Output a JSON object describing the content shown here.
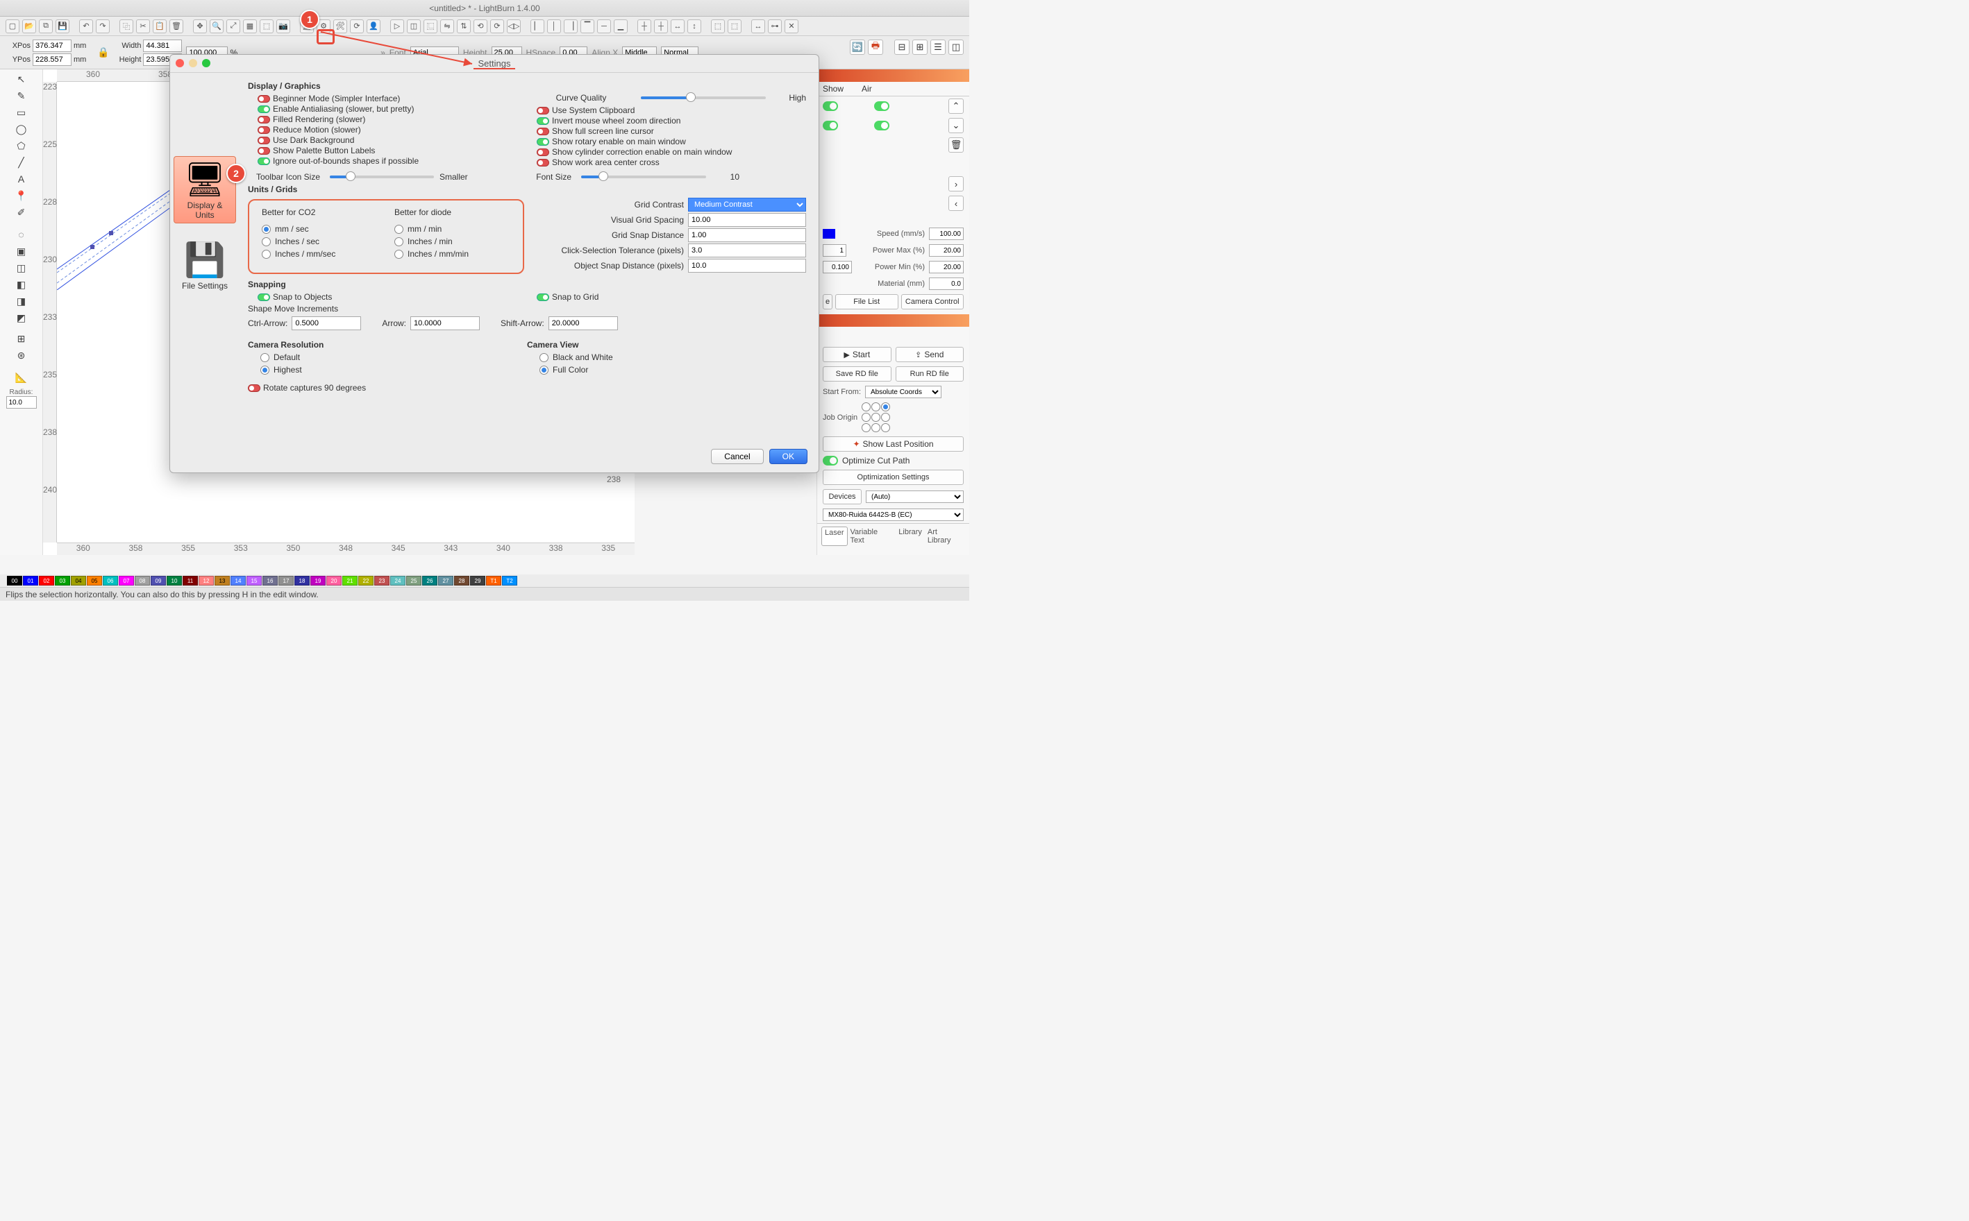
{
  "window": {
    "title": "<untitled> * - LightBurn 1.4.00"
  },
  "propbar": {
    "xpos_label": "XPos",
    "xpos": "376.347",
    "ypos_label": "YPos",
    "ypos": "228.557",
    "unit": "mm",
    "width_label": "Width",
    "width": "44.381",
    "height_label": "Height",
    "height": "23.595",
    "width2": "100.000",
    "font_label": "Font",
    "font": "Arial",
    "h_label": "Height",
    "hval": "25.00",
    "hs_label": "HSpace",
    "hs": "0.00",
    "alignx": "Align X",
    "alignxv": "Middle",
    "norm": "Normal"
  },
  "left": {
    "radius_label": "Radius:",
    "radius": "10.0"
  },
  "ruler_top": [
    "360",
    "358"
  ],
  "ruler_left": [
    "223",
    "225",
    "228",
    "230",
    "233",
    "235",
    "238",
    "240"
  ],
  "ruler_bot": [
    "360",
    "358",
    "355",
    "353",
    "350",
    "348",
    "345",
    "343",
    "340",
    "338",
    "335"
  ],
  "right": {
    "header1": "Show",
    "header2": "Air",
    "speed_label": "Speed (mm/s)",
    "speed": "100.00",
    "pmax_label": "Power Max (%)",
    "pmax": "20.00",
    "pmin_label": "Power Min (%)",
    "pmin": "20.00",
    "mat_label": "Material (mm)",
    "mat": "0.0",
    "one": "1",
    "hundred": "0.100",
    "file_list": "File List",
    "cam_ctl": "Camera Control",
    "start": "Start",
    "send": "Send",
    "save_rd": "Save RD file",
    "run_rd": "Run RD file",
    "start_from": "Start From:",
    "start_from_v": "Absolute Coords",
    "job_origin": "Job Origin",
    "show_last": "Show Last Position",
    "opt_cut": "Optimize Cut Path",
    "opt_set": "Optimization Settings",
    "devices": "Devices",
    "dev_auto": "(Auto)",
    "conn": "MX80-Ruida 6442S-B (EC)",
    "tabs": [
      "Laser",
      "Variable Text",
      "Library",
      "Art Library"
    ]
  },
  "palette": [
    {
      "n": "00",
      "c": "#000000"
    },
    {
      "n": "01",
      "c": "#0000ff"
    },
    {
      "n": "02",
      "c": "#ff0000"
    },
    {
      "n": "03",
      "c": "#00a000"
    },
    {
      "n": "04",
      "c": "#a0a000"
    },
    {
      "n": "05",
      "c": "#ff8000"
    },
    {
      "n": "06",
      "c": "#00c0c0"
    },
    {
      "n": "07",
      "c": "#ff00ff"
    },
    {
      "n": "08",
      "c": "#a0a0a0"
    },
    {
      "n": "09",
      "c": "#5050b0"
    },
    {
      "n": "10",
      "c": "#008040"
    },
    {
      "n": "11",
      "c": "#800000"
    },
    {
      "n": "12",
      "c": "#ff8080"
    },
    {
      "n": "13",
      "c": "#c08020"
    },
    {
      "n": "14",
      "c": "#5080ff"
    },
    {
      "n": "15",
      "c": "#c060ff"
    },
    {
      "n": "16",
      "c": "#707090"
    },
    {
      "n": "17",
      "c": "#909090"
    },
    {
      "n": "18",
      "c": "#3030a0"
    },
    {
      "n": "19",
      "c": "#c000c0"
    },
    {
      "n": "20",
      "c": "#ff60a0"
    },
    {
      "n": "21",
      "c": "#60e000"
    },
    {
      "n": "22",
      "c": "#b0b000"
    },
    {
      "n": "23",
      "c": "#c05050"
    },
    {
      "n": "24",
      "c": "#60c0c0"
    },
    {
      "n": "25",
      "c": "#80a080"
    },
    {
      "n": "26",
      "c": "#008080"
    },
    {
      "n": "27",
      "c": "#6090a0"
    },
    {
      "n": "28",
      "c": "#704830"
    },
    {
      "n": "29",
      "c": "#404040"
    },
    {
      "n": "T1",
      "c": "#ff6000"
    },
    {
      "n": "T2",
      "c": "#0090ff"
    }
  ],
  "statusbar": "Flips the selection horizontally.  You can also do this by pressing H in the edit window.",
  "annotations": {
    "n1": "1",
    "n2": "2"
  },
  "dialog": {
    "title": "Settings",
    "tabs": {
      "display": "Display & Units",
      "file": "File Settings"
    },
    "display_graphics": "Display / Graphics",
    "left_toggles": [
      {
        "on": false,
        "label": "Beginner Mode (Simpler Interface)"
      },
      {
        "on": true,
        "label": "Enable Antialiasing (slower, but pretty)"
      },
      {
        "on": false,
        "label": "Filled Rendering (slower)"
      },
      {
        "on": false,
        "label": "Reduce Motion (slower)"
      },
      {
        "on": false,
        "label": "Use Dark Background"
      },
      {
        "on": false,
        "label": "Show Palette Button Labels"
      },
      {
        "on": true,
        "label": "Ignore out-of-bounds shapes if possible"
      }
    ],
    "curve_quality": "Curve Quality",
    "curve_value": "High",
    "right_toggles": [
      {
        "on": false,
        "label": "Use System Clipboard"
      },
      {
        "on": true,
        "label": "Invert mouse wheel zoom direction"
      },
      {
        "on": false,
        "label": "Show full screen line cursor"
      },
      {
        "on": true,
        "label": "Show rotary enable on main window"
      },
      {
        "on": false,
        "label": "Show cylinder correction enable on main window"
      },
      {
        "on": false,
        "label": "Show work area center cross"
      }
    ],
    "toolbar_icon": "Toolbar Icon Size",
    "toolbar_icon_v": "Smaller",
    "font_size": "Font Size",
    "font_size_v": "10",
    "units_grids": "Units / Grids",
    "co2_hdr": "Better for CO2",
    "diode_hdr": "Better for diode",
    "co2_opts": [
      "mm / sec",
      "Inches / sec",
      "Inches / mm/sec"
    ],
    "diode_opts": [
      "mm / min",
      "Inches / min",
      "Inches / mm/min"
    ],
    "grid_contrast_l": "Grid Contrast",
    "grid_contrast": "Medium Contrast",
    "vgs_l": "Visual Grid Spacing",
    "vgs": "10.00",
    "gsd_l": "Grid Snap Distance",
    "gsd": "1.00",
    "cst_l": "Click-Selection Tolerance (pixels)",
    "cst": "3.0",
    "osd_l": "Object Snap Distance (pixels)",
    "osd": "10.0",
    "snapping": "Snapping",
    "snap_obj": "Snap to Objects",
    "snap_grid": "Snap to Grid",
    "smi": "Shape Move Increments",
    "ctrl_arrow_l": "Ctrl-Arrow:",
    "ctrl_arrow": "0.5000",
    "arrow_l": "Arrow:",
    "arrow": "10.0000",
    "shift_arrow_l": "Shift-Arrow:",
    "shift_arrow": "20.0000",
    "cam_res": "Camera Resolution",
    "cam_res_opts": [
      "Default",
      "Highest"
    ],
    "cam_view": "Camera View",
    "cam_view_opts": [
      "Black and White",
      "Full Color"
    ],
    "rotate_cap": "Rotate captures 90 degrees",
    "ok": "OK",
    "cancel": "Cancel"
  }
}
